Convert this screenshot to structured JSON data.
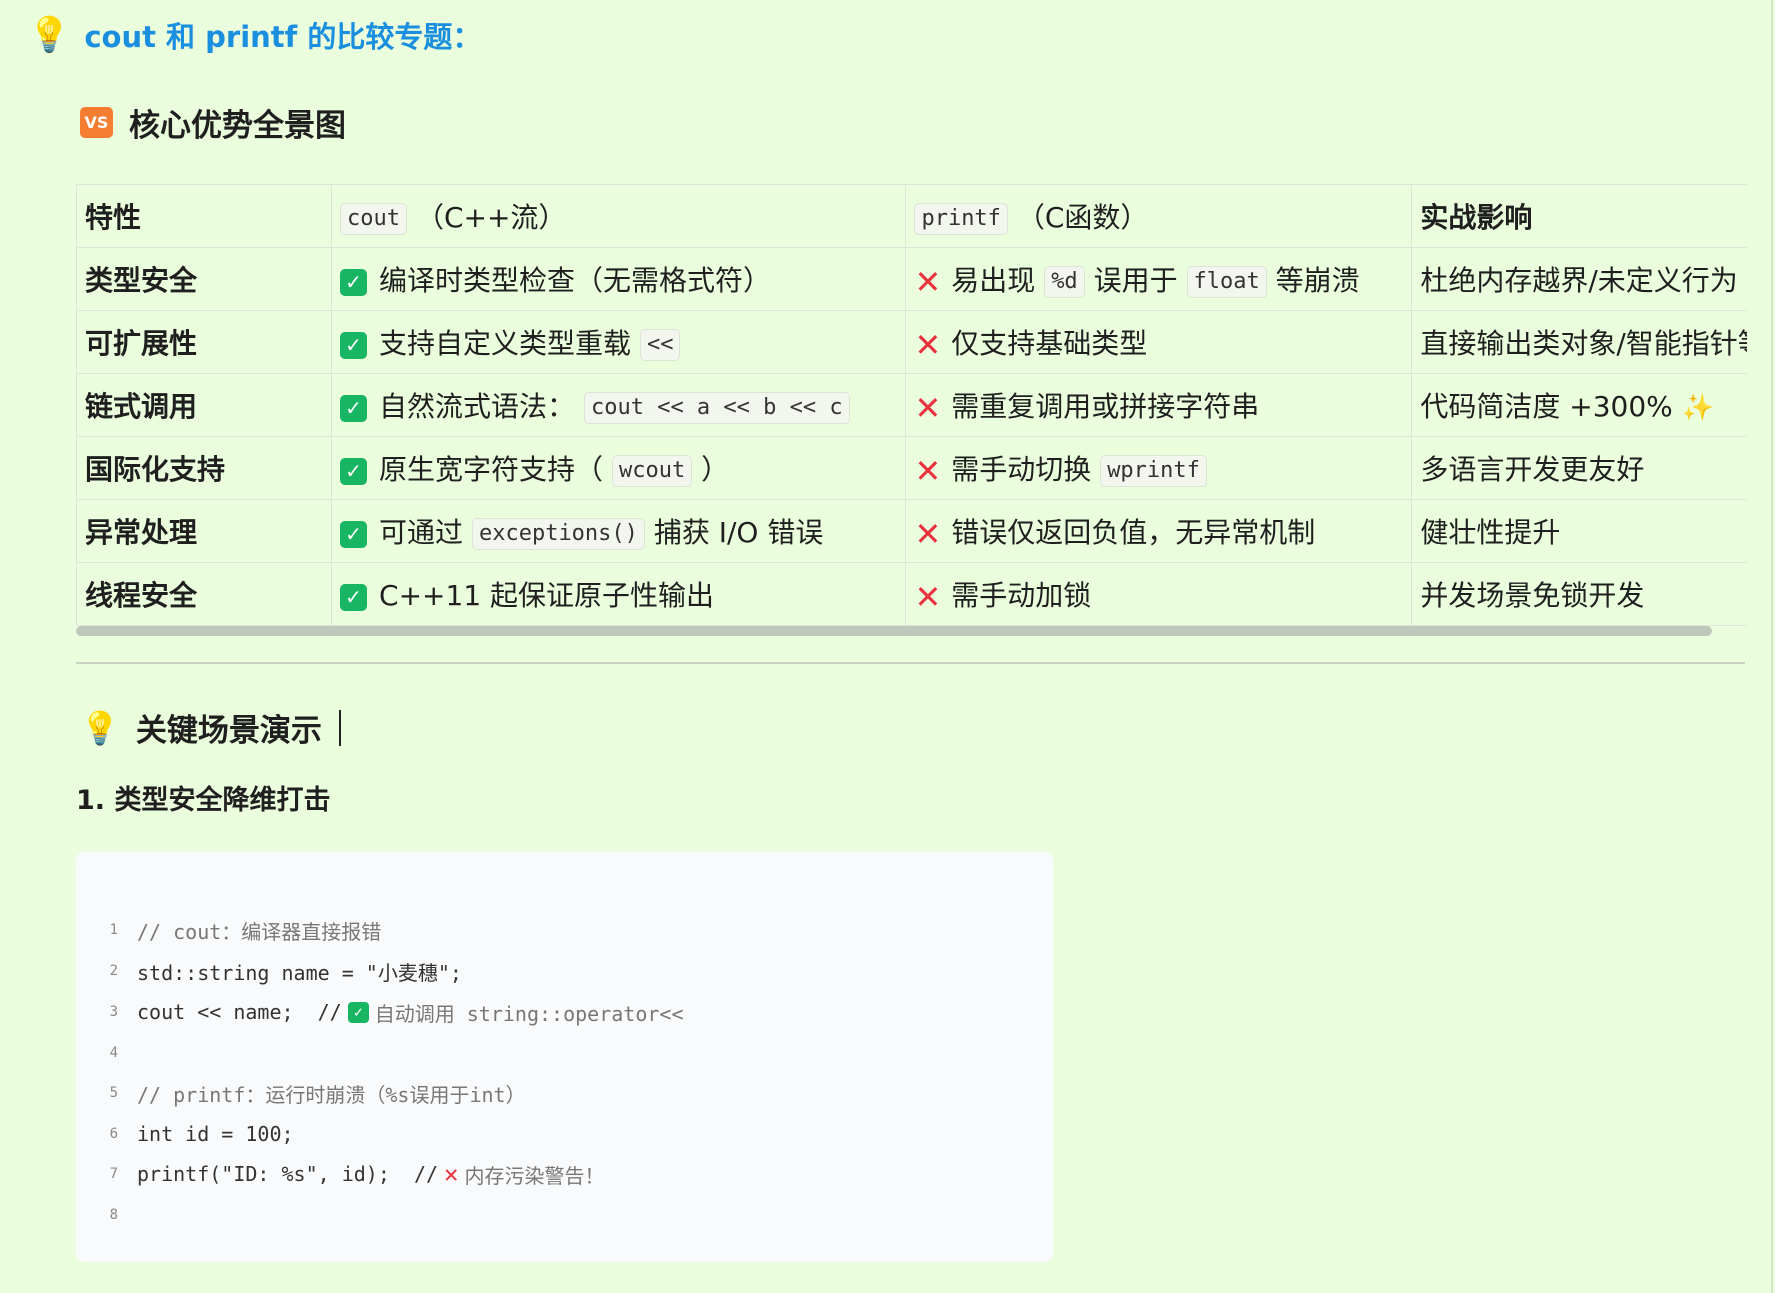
{
  "topic": {
    "icon": "lightbulb-icon",
    "title": "cout 和 printf 的比较专题："
  },
  "section1": {
    "badge": "VS",
    "heading": "核心优势全景图"
  },
  "table": {
    "headers": {
      "feature": "特性",
      "cout_code": "cout",
      "cout_suffix": "（C++流）",
      "printf_code": "printf",
      "printf_suffix": "（C函数）",
      "impact": "实战影响"
    },
    "rows": [
      {
        "feature": "类型安全",
        "cout": [
          "编译时类型检查（无需格式符）"
        ],
        "printf": [
          "易出现",
          "%d",
          "误用于",
          "float",
          "等崩溃"
        ],
        "impact": "杜绝内存越界/未定义行为"
      },
      {
        "feature": "可扩展性",
        "cout": [
          "支持自定义类型重载",
          "<<"
        ],
        "printf": [
          "仅支持基础类型"
        ],
        "impact": "直接输出类对象/智能指针等"
      },
      {
        "feature": "链式调用",
        "cout": [
          "自然流式语法：",
          "cout << a << b << c"
        ],
        "printf": [
          "需重复调用或拼接字符串"
        ],
        "impact": "代码简洁度 +300%",
        "impact_icon": "sparkles-icon"
      },
      {
        "feature": "国际化支持",
        "cout": [
          "原生宽字符支持（",
          "wcout",
          "）"
        ],
        "printf": [
          "需手动切换",
          "wprintf"
        ],
        "impact": "多语言开发更友好"
      },
      {
        "feature": "异常处理",
        "cout": [
          "可通过",
          "exceptions()",
          "捕获 I/O 错误"
        ],
        "printf": [
          "错误仅返回负值，无异常机制"
        ],
        "impact": "健壮性提升"
      },
      {
        "feature": "线程安全",
        "cout": [
          "C++11 起保证原子性输出"
        ],
        "printf": [
          "需手动加锁"
        ],
        "impact": "并发场景免锁开发"
      }
    ]
  },
  "section2": {
    "icon": "lightbulb-icon",
    "heading": "关键场景演示"
  },
  "subsection": {
    "heading": "1. 类型安全降维打击"
  },
  "code": {
    "lines": [
      {
        "n": "1",
        "text": "// cout：编译器直接报错"
      },
      {
        "n": "2",
        "text": "std::string name = \"小麦穗\";"
      },
      {
        "n": "3",
        "pre": "cout << name;  //",
        "post": "自动调用 string::operator<<"
      },
      {
        "n": "4",
        "text": ""
      },
      {
        "n": "5",
        "text": "// printf：运行时崩溃（%s误用于int）"
      },
      {
        "n": "6",
        "text": "int id = 100;"
      },
      {
        "n": "7",
        "pre": "printf(\"ID: %s\", id);  //",
        "post": "内存污染警告！"
      },
      {
        "n": "8",
        "text": ""
      }
    ]
  },
  "colors": {
    "background": "#eafddc",
    "title_blue": "#1a8fe0",
    "check_green": "#18b663",
    "cross_red": "#e8323e",
    "vs_orange": "#f57d31"
  }
}
